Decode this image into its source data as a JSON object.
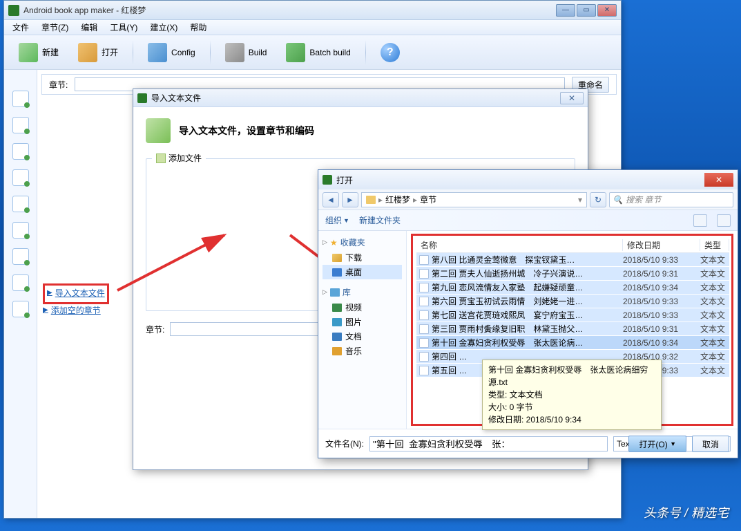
{
  "main_window": {
    "title": "Android book app maker - 红楼梦",
    "menu": {
      "file": "文件",
      "chapter": "章节(Z)",
      "edit": "编辑",
      "tools": "工具(Y)",
      "build": "建立(X)",
      "help": "帮助"
    },
    "toolbar": {
      "new": "新建",
      "open": "打开",
      "config": "Config",
      "build": "Build",
      "batch": "Batch build",
      "help": "?"
    },
    "label_chapter": "章节:",
    "rename": "重命名",
    "links": {
      "import": "导入文本文件",
      "add_blank": "添加空的章节"
    }
  },
  "import_dialog": {
    "title": "导入文本文件",
    "heading": "导入文本文件，设置章节和编码",
    "fieldset_label": "添加文件",
    "add_file_link": "添加文件",
    "label_chapter": "章节:"
  },
  "open_dialog": {
    "title": "打开",
    "breadcrumb": {
      "root": "红楼梦",
      "sub": "章节"
    },
    "search_placeholder": "搜索 章节",
    "toolbar": {
      "organize": "组织",
      "new_folder": "新建文件夹"
    },
    "sidebar": {
      "fav": "收藏夹",
      "downloads": "下载",
      "desktop": "桌面",
      "lib": "库",
      "videos": "视频",
      "pictures": "图片",
      "documents": "文档",
      "music": "音乐"
    },
    "columns": {
      "name": "名称",
      "date": "修改日期",
      "type": "类型"
    },
    "files": [
      {
        "name": "第八回  比通灵金莺微意　探宝钗黛玉…",
        "date": "2018/5/10 9:33",
        "type": "文本文"
      },
      {
        "name": "第二回  贾夫人仙逝扬州城　冷子兴演说…",
        "date": "2018/5/10 9:31",
        "type": "文本文"
      },
      {
        "name": "第九回  恋风流情友入家塾　起嫌疑顽童…",
        "date": "2018/5/10 9:34",
        "type": "文本文"
      },
      {
        "name": "第六回  贾宝玉初试云雨情　刘姥姥一进…",
        "date": "2018/5/10 9:33",
        "type": "文本文"
      },
      {
        "name": "第七回  送宫花贾琏戏熙凤　宴宁府宝玉…",
        "date": "2018/5/10 9:33",
        "type": "文本文"
      },
      {
        "name": "第三回  贾雨村夤缘复旧职　林黛玉抛父…",
        "date": "2018/5/10 9:31",
        "type": "文本文"
      },
      {
        "name": "第十回  金寡妇贪利权受辱　张太医论病…",
        "date": "2018/5/10 9:34",
        "type": "文本文"
      },
      {
        "name": "第四回  …",
        "date": "2018/5/10 9:32",
        "type": "文本文"
      },
      {
        "name": "第五回  …",
        "date": "2018/5/10 9:33",
        "type": "文本文"
      }
    ],
    "filename_label": "文件名(N):",
    "filename_value": "\"第十回  金寡妇贪利权受辱　张：",
    "filter": "Text files(*.txt)",
    "open_btn": "打开(O)",
    "cancel_btn": "取消"
  },
  "tooltip": {
    "line1": "第十回  金寡妇贪利权受辱　张太医论病细穷源.txt",
    "line2": "类型: 文本文档",
    "line3": "大小: 0 字节",
    "line4": "修改日期: 2018/5/10 9:34"
  },
  "watermark": "头条号 / 精选宅"
}
